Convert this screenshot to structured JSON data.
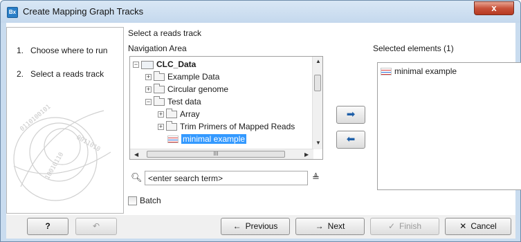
{
  "window": {
    "title": "Create Mapping Graph Tracks",
    "app_icon": "Bx",
    "close_label": "x"
  },
  "steps": [
    {
      "num": "1.",
      "label": "Choose where to run"
    },
    {
      "num": "2.",
      "label": "Select a reads track"
    }
  ],
  "main": {
    "header": "Select a reads track",
    "nav_label": "Navigation Area",
    "selected_label": "Selected elements (1)"
  },
  "tree": {
    "root": "CLC_Data",
    "items": [
      "Example Data",
      "Circular genome",
      "Test data",
      "Array",
      "Trim Primers of Mapped Reads",
      "minimal example"
    ],
    "hscroll_grip": "III"
  },
  "search": {
    "placeholder": "<enter search term>",
    "value": "<enter search term>"
  },
  "selected_elements": [
    "minimal example"
  ],
  "batch": {
    "label": "Batch",
    "checked": false
  },
  "footer": {
    "help": "?",
    "previous": "Previous",
    "next": "Next",
    "finish": "Finish",
    "cancel": "Cancel"
  },
  "colors": {
    "selection": "#3399ff",
    "title_bar": "#c4d8ed",
    "close": "#c8523a"
  }
}
